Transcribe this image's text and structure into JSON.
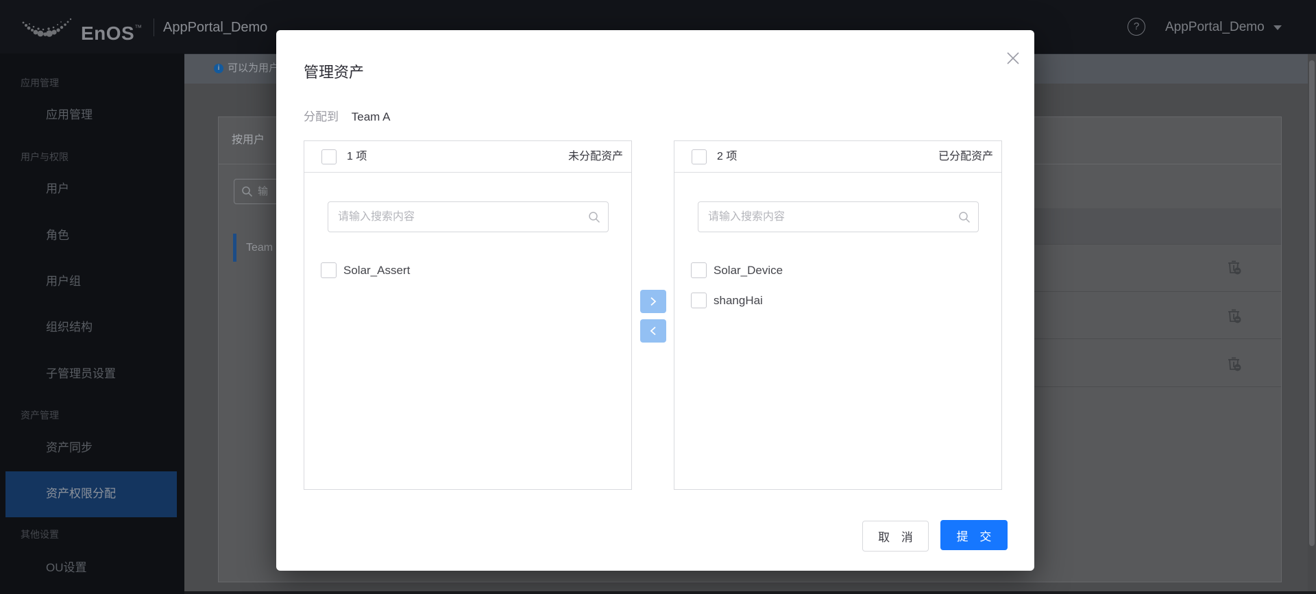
{
  "header": {
    "logo_text": "EnOS",
    "logo_tm": "™",
    "product_name": "AppPortal_Demo",
    "help_symbol": "?",
    "account_name": "AppPortal_Demo"
  },
  "sidebar": {
    "sections": [
      {
        "label": "应用管理",
        "items": [
          {
            "label": "应用管理",
            "active": false
          }
        ]
      },
      {
        "label": "用户与权限",
        "items": [
          {
            "label": "用户",
            "active": false
          },
          {
            "label": "角色",
            "active": false
          },
          {
            "label": "用户组",
            "active": false
          },
          {
            "label": "组织结构",
            "active": false
          },
          {
            "label": "子管理员设置",
            "active": false
          }
        ]
      },
      {
        "label": "资产管理",
        "items": [
          {
            "label": "资产同步",
            "active": false
          },
          {
            "label": "资产权限分配",
            "active": true
          }
        ]
      },
      {
        "label": "其他设置",
        "items": [
          {
            "label": "OU设置",
            "active": false
          }
        ]
      }
    ]
  },
  "background": {
    "info_banner": {
      "text_visible": "可以为用户"
    },
    "panel": {
      "tab_label": "按用户",
      "search_text_visible": "输",
      "tree_item_visible": "Team"
    },
    "table_action_rows": 3
  },
  "modal": {
    "title": "管理资产",
    "assign_label": "分配到",
    "assign_target": "Team A",
    "unassigned_panel": {
      "count_label": "1 项",
      "header_right": "未分配资产",
      "search_placeholder": "请输入搜索内容",
      "items": [
        {
          "label": "Solar_Assert",
          "checked": false
        }
      ]
    },
    "assigned_panel": {
      "count_label": "2 项",
      "header_right": "已分配资产",
      "search_placeholder": "请输入搜索内容",
      "items": [
        {
          "label": "Solar_Device",
          "checked": false
        },
        {
          "label": "shangHai",
          "checked": false
        }
      ]
    },
    "cancel_label": "取 消",
    "submit_label": "提 交"
  },
  "icons": {
    "logo": "enos-dots-crescent",
    "help": "question-circle",
    "account_caret": "caret-down",
    "info": "info-circle",
    "search": "magnifier",
    "close": "close-x",
    "transfer_right": "chevron-right",
    "transfer_left": "chevron-left",
    "row_action": "unassign-asset"
  },
  "colors": {
    "accent_blue": "#1677ff",
    "transfer_button_blue": "#93c0f3",
    "sidebar_active_bg": "#14355f",
    "info_icon_blue": "#135a9d",
    "header_bg": "#121419",
    "sidebar_bg": "#0e1014"
  }
}
